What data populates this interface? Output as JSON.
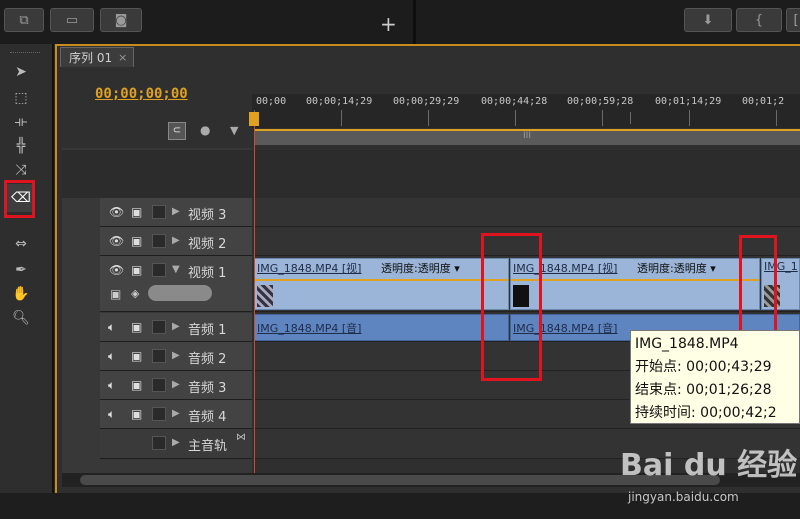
{
  "top_toolbar": {
    "icons": [
      "clip-icon",
      "monitor-icon",
      "camera-icon",
      "add-icon",
      "marker-icon",
      "brace-icon",
      "mark-out-icon"
    ],
    "add_glyph": "+"
  },
  "tools": [
    "selection-tool",
    "track-select-tool",
    "ripple-edit-tool",
    "rolling-edit-tool",
    "rate-stretch-tool",
    "razor-tool",
    "slip-tool",
    "pen-tool",
    "hand-tool",
    "zoom-tool"
  ],
  "sequence_tab": {
    "label": "序列 01",
    "close": "×"
  },
  "timecode": "00;00;00;00",
  "ruler_labels": [
    "00;00",
    "00;00;14;29",
    "00;00;29;29",
    "00;00;44;28",
    "00;00;59;28",
    "00;01;14;29",
    "00;01;2"
  ],
  "zoom_bar_glyph": "III",
  "video_tracks": [
    {
      "label": "视频 3"
    },
    {
      "label": "视频 2"
    },
    {
      "label": "视频 1"
    }
  ],
  "audio_tracks": [
    {
      "label": "音频 1"
    },
    {
      "label": "音频 2"
    },
    {
      "label": "音频 3"
    },
    {
      "label": "音频 4"
    }
  ],
  "master_track": {
    "label": "主音轨"
  },
  "video_clips": [
    {
      "name": "IMG_1848.MP4 [视]",
      "effect": "透明度:透明度 ▾"
    },
    {
      "name": "IMG_1848.MP4 [视]",
      "effect": "透明度:透明度 ▾"
    },
    {
      "name": "IMG_1"
    }
  ],
  "audio_clips": [
    {
      "name": "IMG_1848.MP4 [音]"
    },
    {
      "name": "IMG_1848.MP4 [音]"
    }
  ],
  "tooltip": {
    "title": "IMG_1848.MP4",
    "start": "开始点: 00;00;43;29",
    "end": "结束点: 00;01;26;28",
    "duration": "持续时间: 00;00;42;2"
  },
  "watermark": {
    "brand": "Bai du 经验",
    "url": "jingyan.baidu.com"
  },
  "colors": {
    "timecode": "#e0a020",
    "playhead": "#d04a2a",
    "highlight": "#e0141e",
    "video_clip": "#9bb5d8",
    "audio_clip": "#5f85c1"
  }
}
